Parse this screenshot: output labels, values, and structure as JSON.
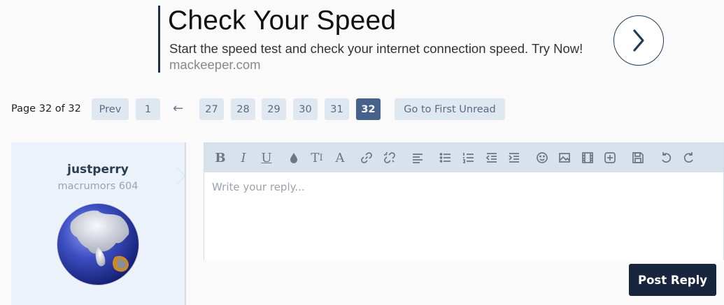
{
  "ad": {
    "title": "Check Your Speed",
    "text": "Start the speed test and check your internet connection speed. Try Now!",
    "domain": "mackeeper.com",
    "arrow_icon": "chevron-right-icon",
    "accent_color": "#1f3b5a"
  },
  "pagination": {
    "label": "Page 32 of 32",
    "prev": "Prev",
    "first": "1",
    "gap": "←",
    "pages": [
      "27",
      "28",
      "29",
      "30",
      "31"
    ],
    "current": "32",
    "first_unread": "Go to First Unread"
  },
  "user": {
    "name": "justperry",
    "title": "macrumors 604"
  },
  "editor": {
    "placeholder": "Write your reply...",
    "toolbar": [
      "bold-icon",
      "italic-icon",
      "underline-icon",
      "text-color-icon",
      "font-size-icon",
      "font-family-icon",
      "link-icon",
      "unlink-icon",
      "align-icon",
      "bulleted-list-icon",
      "numbered-list-icon",
      "outdent-icon",
      "indent-icon",
      "smilie-icon",
      "image-icon",
      "media-icon",
      "insert-icon",
      "save-draft-icon",
      "undo-icon",
      "redo-icon"
    ]
  },
  "actions": {
    "post_reply": "Post Reply"
  },
  "colors": {
    "current_page": "#47628a",
    "page_button": "#dfe7f0",
    "post_button": "#17253d"
  }
}
